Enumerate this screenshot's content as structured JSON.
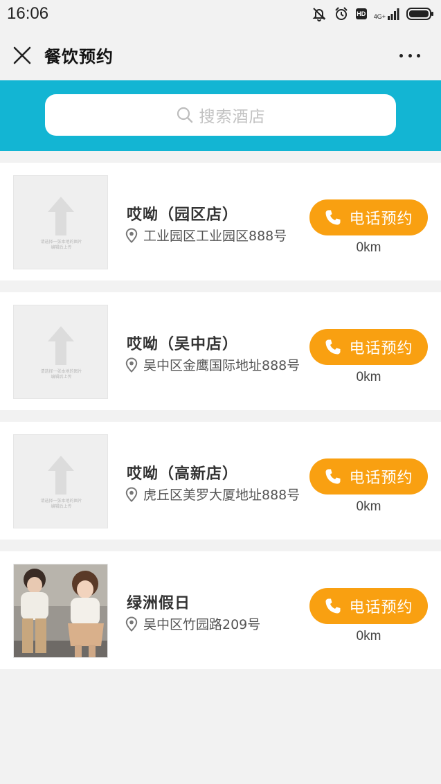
{
  "status_bar": {
    "time": "16:06",
    "network": "4G+",
    "hd": "HD"
  },
  "header": {
    "title": "餐饮预约"
  },
  "search": {
    "placeholder": "搜索酒店"
  },
  "placeholder_image": {
    "caption_line1": "请选择一张本地的图片",
    "caption_line2": "编辑后上传"
  },
  "stores": [
    {
      "name": "哎呦（园区店）",
      "address": "工业园区工业园区888号",
      "call_label": "电话预约",
      "distance": "0km",
      "image": "placeholder"
    },
    {
      "name": "哎呦（吴中店）",
      "address": "吴中区金鹰国际地址888号",
      "call_label": "电话预约",
      "distance": "0km",
      "image": "placeholder"
    },
    {
      "name": "哎呦（高新店）",
      "address": "虎丘区美罗大厦地址888号",
      "call_label": "电话预约",
      "distance": "0km",
      "image": "placeholder"
    },
    {
      "name": "绿洲假日",
      "address": "吴中区竹园路209号",
      "call_label": "电话预约",
      "distance": "0km",
      "image": "photo"
    }
  ],
  "colors": {
    "header_bg": "#13b5d3",
    "call_button": "#f9a011",
    "page_bg": "#f2f2f2"
  }
}
